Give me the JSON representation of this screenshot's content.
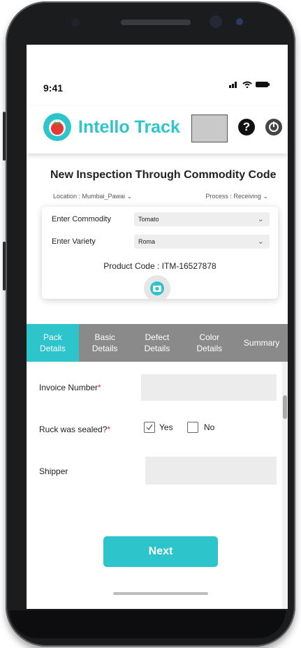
{
  "status": {
    "time": "9:41"
  },
  "app": {
    "title": "Intello Track"
  },
  "page": {
    "title": "New Inspection Through Commodity Code",
    "location": "Location : Mumbai_Pawai",
    "process": "Process : Receiving"
  },
  "form": {
    "commodity_label": "Enter Commodity",
    "commodity_value": "Tomato",
    "variety_label": "Enter  Variety",
    "variety_value": "Roma",
    "product_code": "Product Code : ITM-16527878"
  },
  "tabs": [
    {
      "line1": "Pack",
      "line2": "Details"
    },
    {
      "line1": "Basic",
      "line2": "Details"
    },
    {
      "line1": "Defect",
      "line2": "Details"
    },
    {
      "line1": "Color",
      "line2": "Details"
    },
    {
      "line1": "Summary",
      "line2": ""
    }
  ],
  "pack": {
    "invoice_label": "Invoice Number",
    "sealed_label": "Ruck was sealed?",
    "yes": "Yes",
    "no": "No",
    "shipper_label": "Shipper",
    "required_mark": "*",
    "next_label": "Next"
  },
  "colors": {
    "accent": "#2ec4cc",
    "tab_bar": "#8a8a8a"
  }
}
